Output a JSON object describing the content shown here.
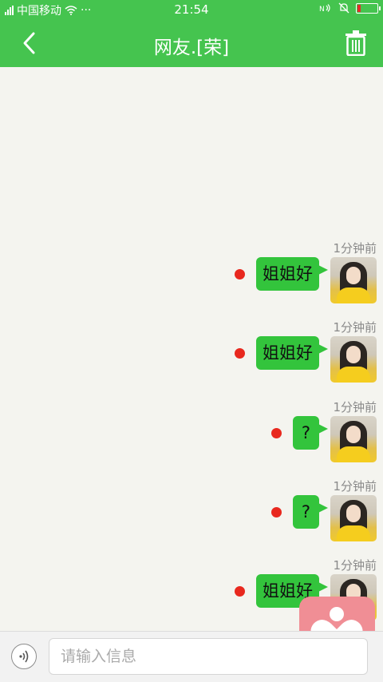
{
  "status_bar": {
    "carrier": "中国移动",
    "more": "···",
    "time": "21:54",
    "battery_level": 0.15,
    "icons": [
      "signal-icon",
      "wifi-icon",
      "nfc-icon",
      "mute-bell-icon",
      "battery-icon"
    ]
  },
  "header": {
    "title": "网友.[荣]",
    "back_icon": "chevron-left-icon",
    "delete_icon": "trash-icon"
  },
  "messages": [
    {
      "time": "1分钟前",
      "text": "姐姐好",
      "unread": true
    },
    {
      "time": "1分钟前",
      "text": "姐姐好",
      "unread": true
    },
    {
      "time": "1分钟前",
      "text": "?",
      "unread": true
    },
    {
      "time": "1分钟前",
      "text": "?",
      "unread": true
    },
    {
      "time": "1分钟前",
      "text": "姐姐好",
      "unread": true
    }
  ],
  "input": {
    "placeholder": "请输入信息",
    "voice_icon": "voice-wave-icon"
  },
  "floating_app": {
    "icon": "heart-person-icon"
  },
  "colors": {
    "header": "#45c44f",
    "bubble": "#33c43c",
    "unread_dot": "#e8281e",
    "background": "#f4f4ef",
    "floating_app": "#f08e95"
  }
}
